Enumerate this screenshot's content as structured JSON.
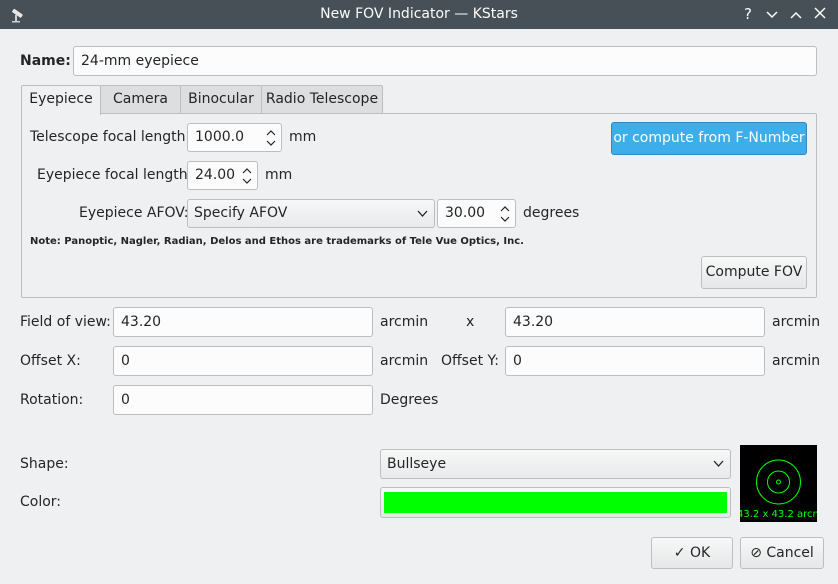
{
  "window": {
    "title": "New FOV Indicator — KStars",
    "buttons": {
      "help": "?",
      "minimize": "∨",
      "maximize": "∧",
      "close": "✕"
    }
  },
  "name": {
    "label": "Name:",
    "value": "24-mm eyepiece"
  },
  "tabs": [
    {
      "label": "Eyepiece",
      "active": true
    },
    {
      "label": "Camera",
      "active": false
    },
    {
      "label": "Binocular",
      "active": false
    },
    {
      "label": "Radio Telescope",
      "active": false
    }
  ],
  "eyepiece": {
    "telescope_focal_label": "Telescope focal length:",
    "telescope_focal_value": "1000.0",
    "telescope_focal_unit": "mm",
    "eyepiece_focal_label": "Eyepiece focal length:",
    "eyepiece_focal_value": "24.00",
    "eyepiece_focal_unit": "mm",
    "afov_label": "Eyepiece AFOV:",
    "afov_select": "Specify AFOV",
    "afov_value": "30.00",
    "afov_unit": "degrees",
    "fnumber_button": "or compute from F-Number",
    "note": "Note: Panoptic, Nagler, Radian, Delos and Ethos are trademarks of Tele Vue Optics, Inc.",
    "compute_button": "Compute FOV"
  },
  "fov": {
    "label": "Field of view:",
    "width": "43.20",
    "width_unit": "arcmin",
    "x_sep": "x",
    "height": "43.20",
    "height_unit": "arcmin"
  },
  "offset": {
    "x_label": "Offset X:",
    "x_value": "0",
    "x_unit": "arcmin",
    "y_label": "Offset Y:",
    "y_value": "0",
    "y_unit": "arcmin"
  },
  "rotation": {
    "label": "Rotation:",
    "value": "0",
    "unit": "Degrees"
  },
  "shape": {
    "label": "Shape:",
    "value": "Bullseye"
  },
  "color": {
    "label": "Color:",
    "value": "#00ff00"
  },
  "preview": {
    "caption": "43.2 x 43.2 arcmin",
    "color": "#00ff00"
  },
  "dialog_buttons": {
    "ok": "OK",
    "cancel": "Cancel"
  },
  "colors": {
    "titlebar": "#475057",
    "accent": "#3daee9",
    "background": "#eff0f1"
  }
}
